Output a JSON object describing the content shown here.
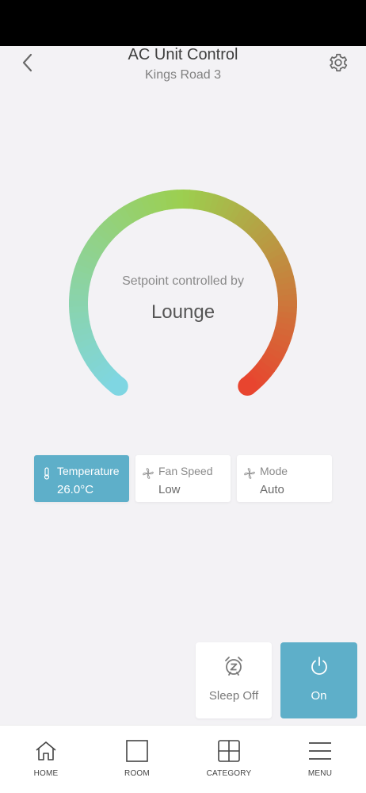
{
  "header": {
    "title": "AC Unit Control",
    "subtitle": "Kings Road 3",
    "back_icon": "chevron-left-icon",
    "settings_icon": "gear-icon"
  },
  "dial": {
    "caption": "Setpoint controlled by",
    "value": "Lounge",
    "gradient_colors": [
      "#7fd6e2",
      "#9ccf4f",
      "#e8452f"
    ]
  },
  "cards": [
    {
      "label": "Temperature",
      "value": "26.0°C",
      "icon": "thermometer-icon",
      "active": true
    },
    {
      "label": "Fan Speed",
      "value": "Low",
      "icon": "fan-icon",
      "active": false
    },
    {
      "label": "Mode",
      "value": "Auto",
      "icon": "fan-icon",
      "active": false
    }
  ],
  "actions": {
    "sleep": {
      "label": "Sleep Off",
      "icon": "alarm-clock-z-icon"
    },
    "power": {
      "label": "On",
      "icon": "power-icon"
    }
  },
  "nav": [
    {
      "label": "HOME",
      "icon": "home-icon"
    },
    {
      "label": "ROOM",
      "icon": "square-icon"
    },
    {
      "label": "CATEGORY",
      "icon": "grid-icon"
    },
    {
      "label": "MENU",
      "icon": "hamburger-icon"
    }
  ],
  "colors": {
    "accent": "#5eafc9",
    "background": "#f3f2f5"
  }
}
